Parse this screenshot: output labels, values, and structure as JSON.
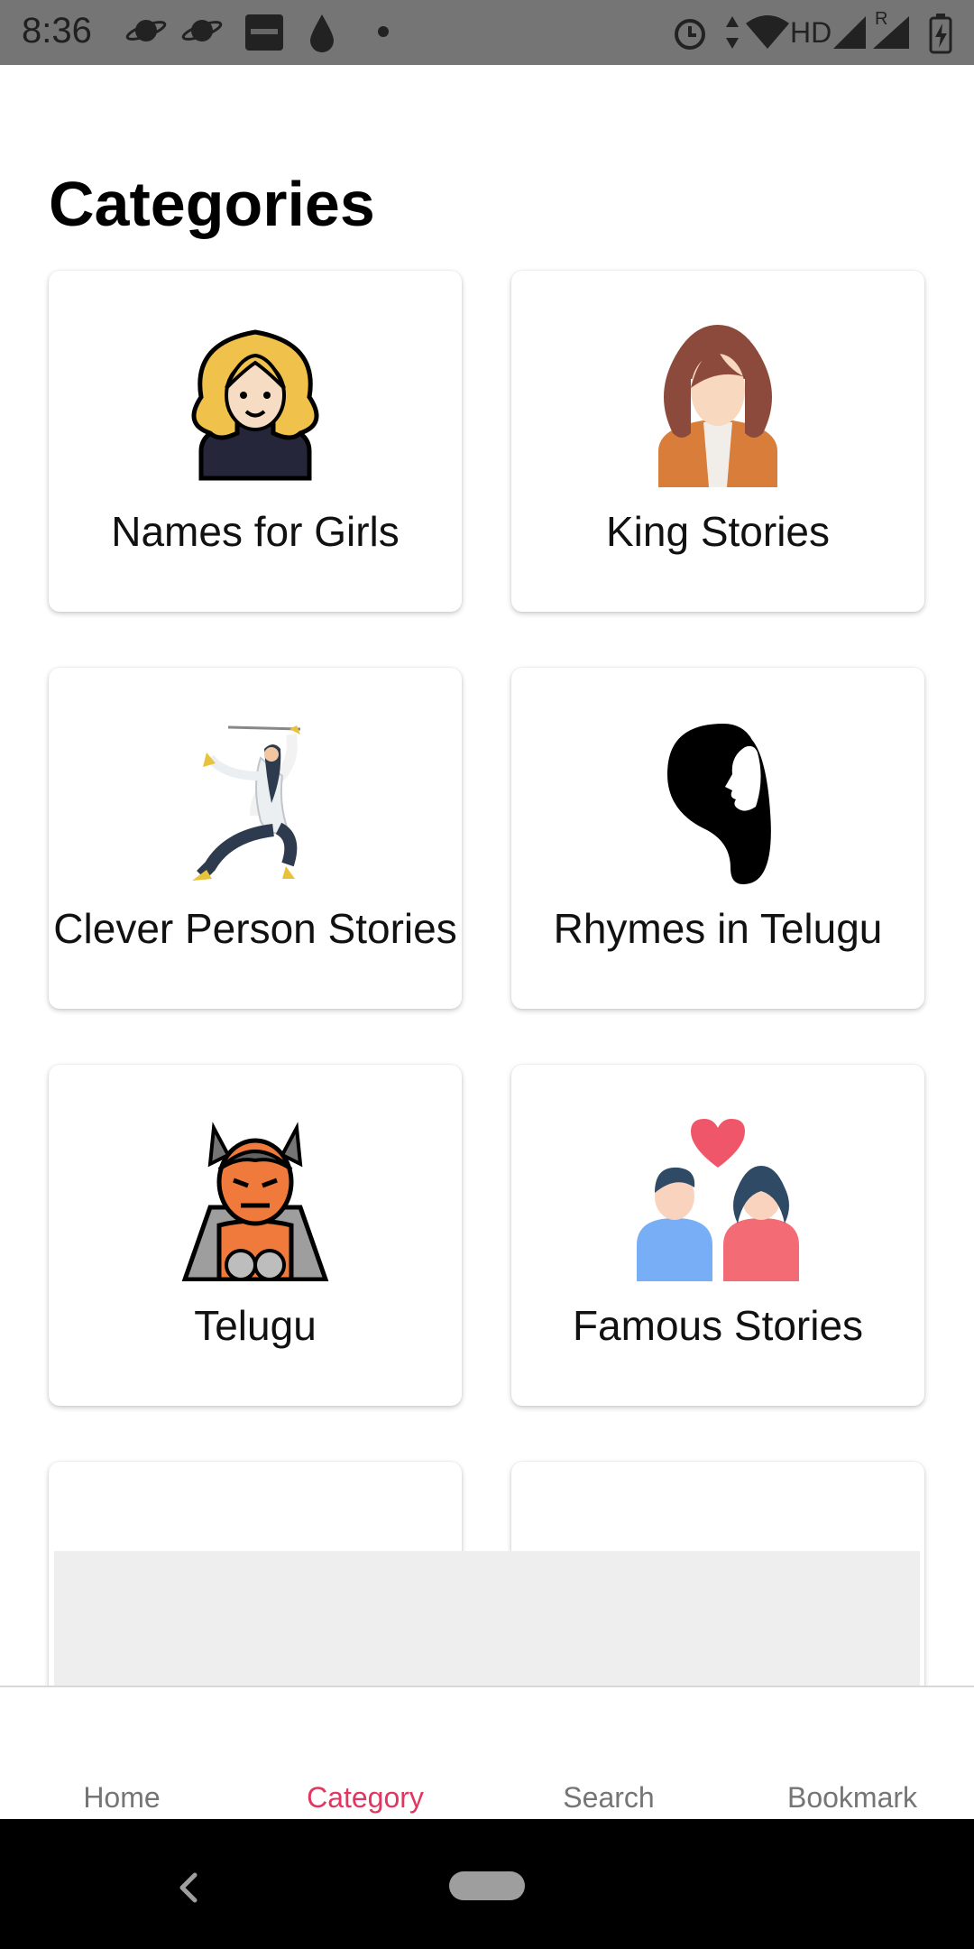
{
  "status_bar": {
    "time": "8:36",
    "network_label": "HD",
    "roaming": "R"
  },
  "page": {
    "title": "Categories"
  },
  "categories": [
    {
      "label": "Names for Girls",
      "icon": "blonde-girl-icon"
    },
    {
      "label": "King Stories",
      "icon": "woman-brown-hair-icon"
    },
    {
      "label": "Clever Person Stories",
      "icon": "martial-artist-icon"
    },
    {
      "label": "Rhymes in Telugu",
      "icon": "face-silhouette-icon"
    },
    {
      "label": "Telugu",
      "icon": "demon-icon"
    },
    {
      "label": "Famous Stories",
      "icon": "couple-heart-icon"
    }
  ],
  "bottom_nav": {
    "items": [
      {
        "label": "Home",
        "active": false
      },
      {
        "label": "Category",
        "active": true
      },
      {
        "label": "Search",
        "active": false
      },
      {
        "label": "Bookmark",
        "active": false
      }
    ]
  },
  "colors": {
    "accent": "#e2355f",
    "nav_inactive": "#757575",
    "status_bar": "#757575",
    "ad_placeholder": "#eeeeee"
  }
}
